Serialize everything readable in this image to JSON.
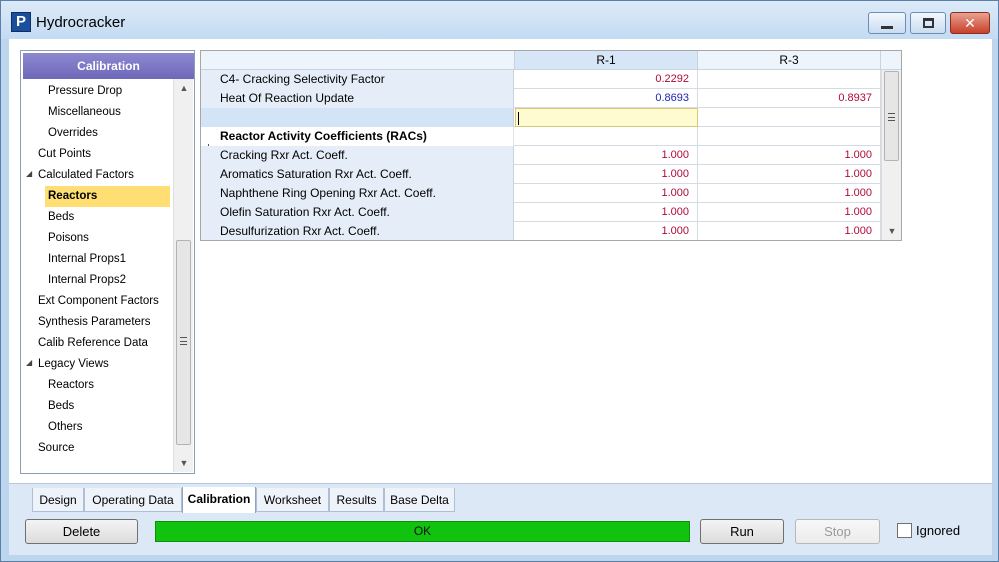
{
  "window": {
    "title": "Hydrocracker",
    "app_icon_letter": "P"
  },
  "tree": {
    "header": "Calibration",
    "items": [
      {
        "label": "Pressure Drop"
      },
      {
        "label": "Miscellaneous"
      },
      {
        "label": "Overrides"
      },
      {
        "label": "Cut Points"
      },
      {
        "label": "Calculated Factors"
      },
      {
        "label": "Reactors",
        "selected": true
      },
      {
        "label": "Beds"
      },
      {
        "label": "Poisons"
      },
      {
        "label": "Internal Props1"
      },
      {
        "label": "Internal Props2"
      },
      {
        "label": "Ext Component Factors"
      },
      {
        "label": "Synthesis Parameters"
      },
      {
        "label": "Calib Reference Data"
      },
      {
        "label": "Legacy Views"
      },
      {
        "label": "Reactors"
      },
      {
        "label": "Beds"
      },
      {
        "label": "Others"
      },
      {
        "label": "Source"
      }
    ]
  },
  "grid": {
    "columns": [
      "R-1",
      "R-3"
    ],
    "rows": [
      {
        "label": "C4- Cracking Selectivity Factor",
        "r1": "0.2292",
        "r3": ""
      },
      {
        "label": "Heat Of Reaction Update",
        "r1": "0.8693",
        "r3": "0.8937"
      },
      {
        "label": "",
        "r1": "",
        "r3": ""
      },
      {
        "label": "Reactor Activity Coefficients (RACs)",
        "r1": "",
        "r3": ""
      },
      {
        "label": "Cracking Rxr Act. Coeff.",
        "r1": "1.000",
        "r3": "1.000"
      },
      {
        "label": "Aromatics Saturation Rxr Act. Coeff.",
        "r1": "1.000",
        "r3": "1.000"
      },
      {
        "label": "Naphthene Ring Opening Rxr Act. Coeff.",
        "r1": "1.000",
        "r3": "1.000"
      },
      {
        "label": "Olefin Saturation Rxr Act. Coeff.",
        "r1": "1.000",
        "r3": "1.000"
      },
      {
        "label": "Desulfurization Rxr Act. Coeff.",
        "r1": "1.000",
        "r3": "1.000"
      }
    ]
  },
  "tabs": [
    {
      "label": "Design"
    },
    {
      "label": "Operating Data"
    },
    {
      "label": "Calibration",
      "active": true
    },
    {
      "label": "Worksheet"
    },
    {
      "label": "Results"
    },
    {
      "label": "Base Delta"
    }
  ],
  "footer": {
    "delete_label": "Delete",
    "status_text": "OK",
    "run_label": "Run",
    "stop_label": "Stop",
    "ignored_label": "Ignored",
    "ignored_checked": false
  },
  "colors": {
    "status_ok": "#11c20f",
    "selected_tree_item": "#ffdf74",
    "calculated_value": "#1f22b2",
    "specified_value": "#b00a3a"
  }
}
